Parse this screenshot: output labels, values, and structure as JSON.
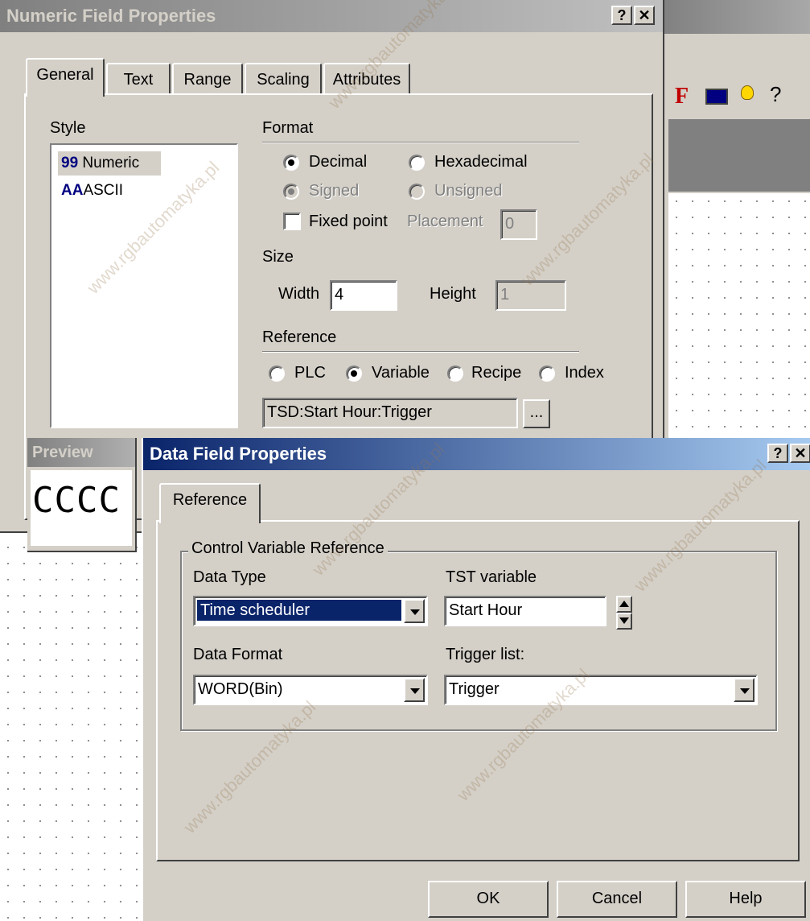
{
  "numeric_dialog": {
    "title": "Numeric Field Properties",
    "help_btn": "?",
    "close_btn": "✕",
    "tabs": [
      "General",
      "Text",
      "Range",
      "Scaling",
      "Attributes"
    ],
    "style_label": "Style",
    "style_items": [
      {
        "prefix": "99",
        "label": "Numeric"
      },
      {
        "prefix": "AA",
        "label": "ASCII"
      }
    ],
    "format_label": "Format",
    "decimal": "Decimal",
    "hexadecimal": "Hexadecimal",
    "signed": "Signed",
    "unsigned": "Unsigned",
    "fixed_point": "Fixed point",
    "placement_label": "Placement",
    "placement_value": "0",
    "size_label": "Size",
    "width_label": "Width",
    "width_value": "4",
    "height_label": "Height",
    "height_value": "1",
    "reference_label": "Reference",
    "ref_plc": "PLC",
    "ref_variable": "Variable",
    "ref_recipe": "Recipe",
    "ref_index": "Index",
    "reference_value": "TSD:Start Hour:Trigger",
    "browse_btn": "...",
    "preview_label": "Preview",
    "preview_text": "CCCC"
  },
  "toolbar_icons": [
    "font-F-icon",
    "display-icon",
    "bulb-icon",
    "help-pointer-icon"
  ],
  "data_dialog": {
    "title": "Data Field Properties",
    "help_btn": "?",
    "close_btn": "✕",
    "tab": "Reference",
    "group_label": "Control Variable Reference",
    "data_type_label": "Data Type",
    "data_type_value": "Time scheduler",
    "tst_label": "TST variable",
    "tst_value": "Start Hour",
    "data_format_label": "Data Format",
    "data_format_value": "WORD(Bin)",
    "trigger_label": "Trigger list:",
    "trigger_value": "Trigger",
    "ok": "OK",
    "cancel": "Cancel",
    "help": "Help"
  },
  "watermark": "www.rgbautomatyka.pl"
}
